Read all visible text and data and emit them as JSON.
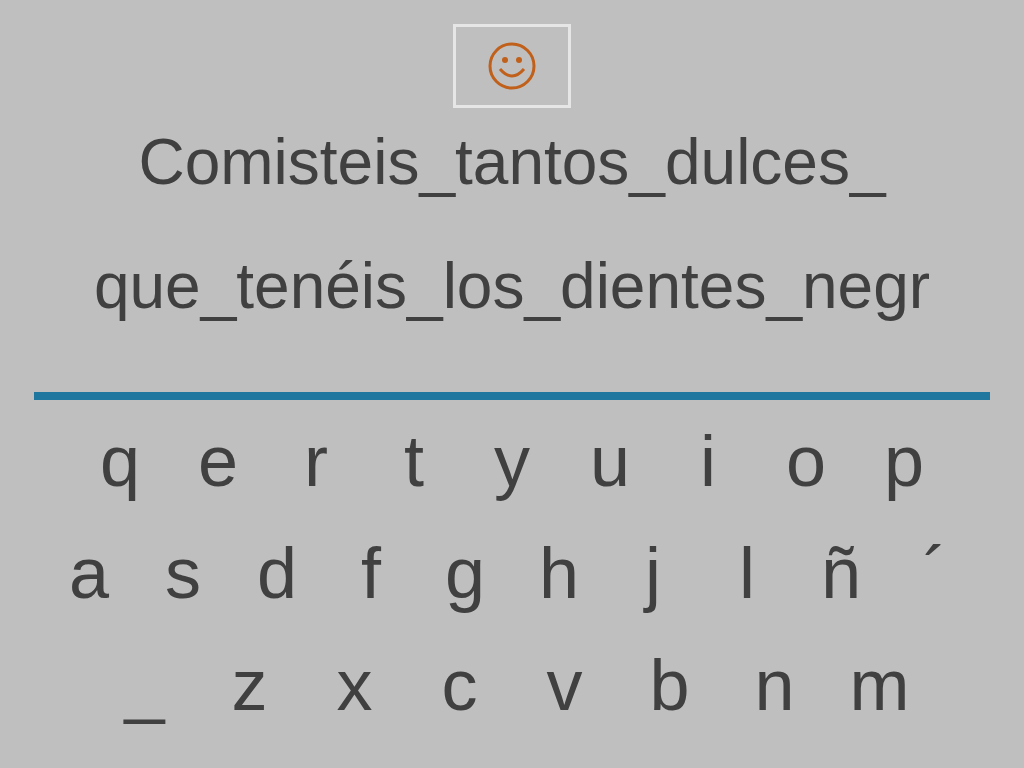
{
  "phrase_lines": [
    "Comisteis_tantos_dulces_",
    "que_tenéis_los_dientes_negr"
  ],
  "keyboard_rows": [
    [
      "q",
      "e",
      "r",
      "t",
      "y",
      "u",
      "i",
      "o",
      "p"
    ],
    [
      "a",
      "s",
      "d",
      "f",
      "g",
      "h",
      "j",
      "l",
      "ñ",
      "´"
    ],
    [
      "_",
      "z",
      "x",
      "c",
      "v",
      "b",
      "n",
      "m"
    ]
  ]
}
